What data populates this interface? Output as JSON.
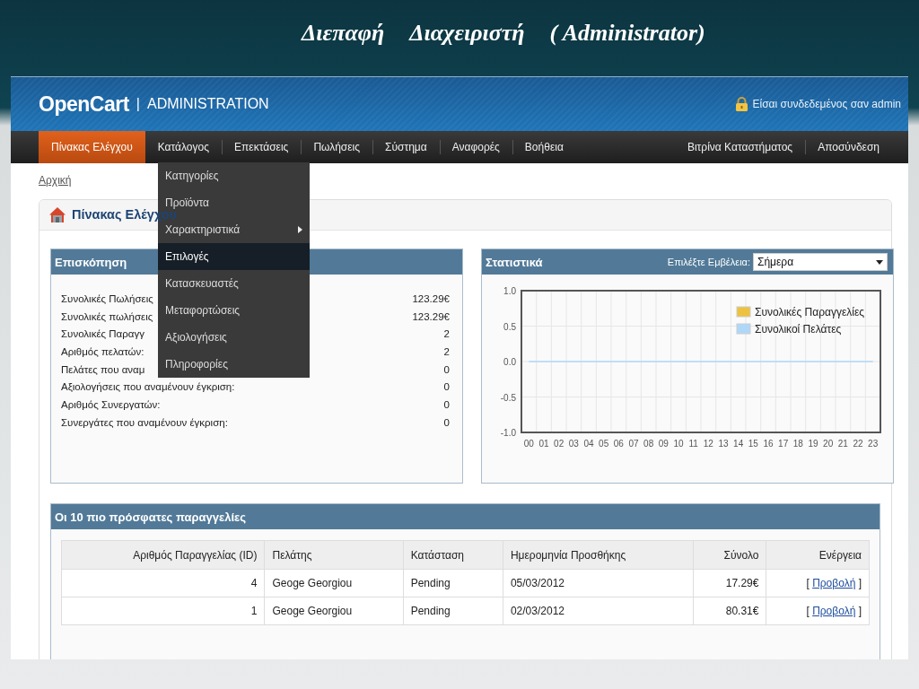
{
  "slide_title": {
    "parts": [
      "Διεπαφή",
      "Διαχειριστή",
      "( Administrator)"
    ]
  },
  "header": {
    "logo": "OpenCart",
    "logo_separator": "|",
    "logo_subtitle": "ADMINISTRATION",
    "login_text": "Είσαι συνδεδεμένος σαν admin"
  },
  "nav": {
    "items": [
      {
        "label": "Πίνακας Ελέγχου",
        "selected": true
      },
      {
        "label": "Κατάλογος",
        "selected": false
      },
      {
        "label": "Επεκτάσεις",
        "selected": false
      },
      {
        "label": "Πωλήσεις",
        "selected": false
      },
      {
        "label": "Σύστημα",
        "selected": false
      },
      {
        "label": "Αναφορές",
        "selected": false
      },
      {
        "label": "Βοήθεια",
        "selected": false
      }
    ],
    "right_items": [
      {
        "label": "Βιτρίνα Καταστήματος",
        "selected": false
      },
      {
        "label": "Αποσύνδεση",
        "selected": false
      }
    ]
  },
  "dropdown_menu": {
    "items": [
      {
        "label": "Κατηγορίες",
        "selected": false,
        "submenu": false
      },
      {
        "label": "Προϊόντα",
        "selected": false,
        "submenu": false
      },
      {
        "label": "Χαρακτηριστικά",
        "selected": false,
        "submenu": true
      },
      {
        "label": "Επιλογές",
        "selected": true,
        "submenu": false
      },
      {
        "label": "Κατασκευαστές",
        "selected": false,
        "submenu": false
      },
      {
        "label": "Μεταφορτώσεις",
        "selected": false,
        "submenu": false
      },
      {
        "label": "Αξιολογήσεις",
        "selected": false,
        "submenu": false
      },
      {
        "label": "Πληροφορίες",
        "selected": false,
        "submenu": false
      }
    ]
  },
  "breadcrumb": "Αρχική",
  "dashboard": {
    "title": "Πίνακας Ελέγχου",
    "overview": {
      "title": "Επισκόπηση",
      "rows": [
        {
          "label": "Συνολικές Πωλήσεις",
          "value": "123.29€"
        },
        {
          "label": "Συνολικές πωλήσεις",
          "value": "123.29€"
        },
        {
          "label": "Συνολικές Παραγγ",
          "value": "2"
        },
        {
          "label": "Αριθμός πελατών:",
          "value": "2"
        },
        {
          "label": "Πελάτες που αναμ",
          "value": "0"
        },
        {
          "label": "Αξιολογήσεις που αναμένουν έγκριση:",
          "value": "0"
        },
        {
          "label": "Αριθμός Συνεργατών:",
          "value": "0"
        },
        {
          "label": "Συνεργάτες που αναμένουν έγκριση:",
          "value": "0"
        }
      ]
    },
    "statistics": {
      "title": "Στατιστικά",
      "range_label": "Επιλέξτε Εμβέλεια:",
      "range_value": "Σήμερα",
      "chart_data": {
        "type": "line",
        "categories": [
          "00",
          "01",
          "02",
          "03",
          "04",
          "05",
          "06",
          "07",
          "08",
          "09",
          "10",
          "11",
          "12",
          "13",
          "14",
          "15",
          "16",
          "17",
          "18",
          "19",
          "20",
          "21",
          "22",
          "23"
        ],
        "ylim": [
          -1,
          1
        ],
        "legend": "upper right",
        "grid": true,
        "yticks": [
          {
            "value": 1,
            "label": "1.0"
          },
          {
            "value": 0.5,
            "label": "0.5"
          },
          {
            "value": 0,
            "label": "0.0"
          },
          {
            "value": -0.5,
            "label": "-0.5"
          },
          {
            "value": -1,
            "label": "-1.0"
          }
        ],
        "series": [
          {
            "name": "Συνολικές Παραγγελίες",
            "color": "#edc240",
            "values": [
              null,
              null,
              null,
              null,
              null,
              null,
              null,
              null,
              null,
              null,
              null,
              null,
              null,
              null,
              null,
              null,
              null,
              null,
              null,
              null,
              null,
              null,
              null,
              null
            ]
          },
          {
            "name": "Συνολικοί Πελάτες",
            "color": "#afd8f8",
            "values": [
              0,
              0,
              0,
              0,
              0,
              0,
              0,
              0,
              0,
              0,
              0,
              0,
              0,
              0,
              0,
              0,
              0,
              0,
              0,
              0,
              0,
              0,
              0,
              0
            ]
          }
        ]
      }
    },
    "latest_orders": {
      "title": "Οι 10 πιο πρόσφατες παραγγελίες",
      "columns": [
        "Αριθμός Παραγγελίας (ID)",
        "Πελάτης",
        "Κατάσταση",
        "Ημερομηνία Προσθήκης",
        "Σύνολο",
        "Ενέργεια"
      ],
      "rows": [
        {
          "order_id": "4",
          "customer": "Geoge Georgiou",
          "status": "Pending",
          "date_added": "05/03/2012",
          "total": "17.29€",
          "action_open": "[",
          "action": "Προβολή",
          "action_close": "]"
        },
        {
          "order_id": "1",
          "customer": "Geoge Georgiou",
          "status": "Pending",
          "date_added": "02/03/2012",
          "total": "80.31€",
          "action_open": "[",
          "action": "Προβολή",
          "action_close": "]"
        }
      ]
    }
  }
}
